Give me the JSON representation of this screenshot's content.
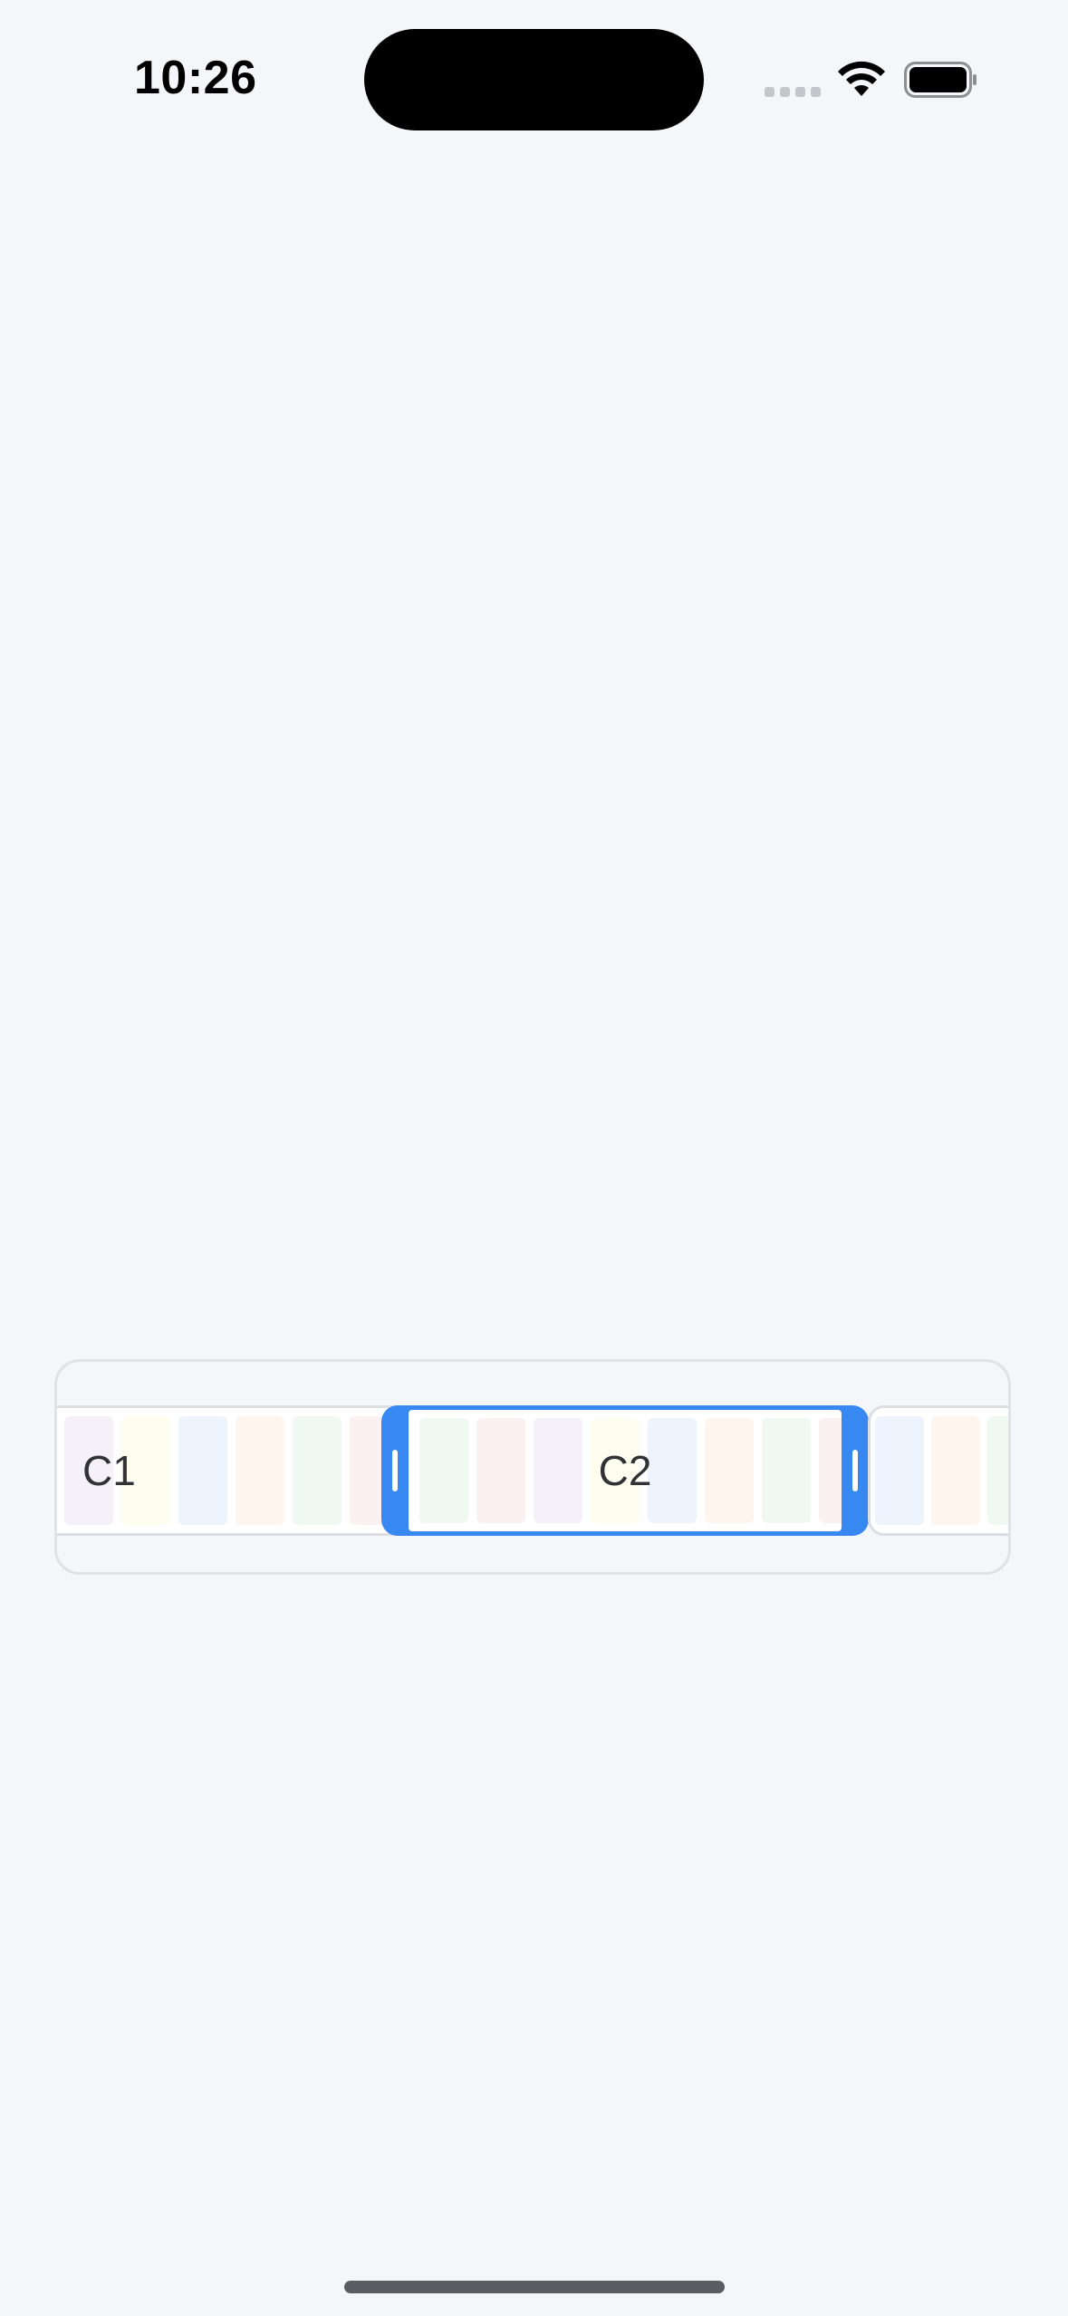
{
  "status_bar": {
    "time": "10:26",
    "icons": [
      "cellular-signal-icon",
      "wifi-icon",
      "battery-icon"
    ]
  },
  "timeline": {
    "selected_clip": "C2",
    "accent_color": "#3888f2",
    "clips": [
      {
        "label": "C1",
        "selected": false,
        "frame_colors": [
          "#f6f0f8",
          "#fefdf0",
          "#eef4fd",
          "#fef6ee",
          "#eff8f1",
          "#fcf1f1"
        ]
      },
      {
        "label": "C2",
        "selected": true,
        "frame_colors": [
          "#eff8f1",
          "#fcf1f1",
          "#f6f0f8",
          "#fefdf0",
          "#eef4fd",
          "#fef6ee",
          "#eff8f1",
          "#fcf1f1"
        ]
      },
      {
        "label": "",
        "selected": false,
        "frame_colors": [
          "#eef4fd",
          "#fef6ee",
          "#eff8f1"
        ]
      }
    ]
  }
}
